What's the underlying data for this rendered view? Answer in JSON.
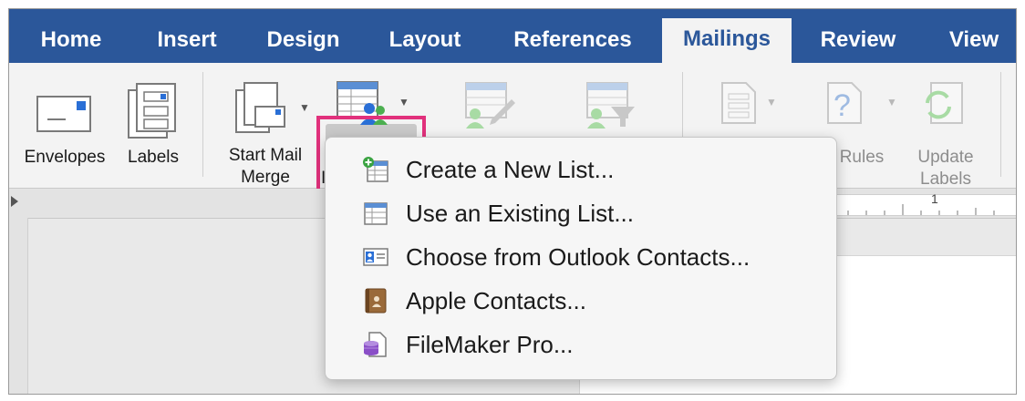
{
  "tabs": [
    {
      "label": "Home"
    },
    {
      "label": "Insert"
    },
    {
      "label": "Design"
    },
    {
      "label": "Layout"
    },
    {
      "label": "References"
    },
    {
      "label": "Mailings"
    },
    {
      "label": "Review"
    },
    {
      "label": "View"
    }
  ],
  "active_tab": "Mailings",
  "ribbon": {
    "envelopes": "Envelopes",
    "labels": "Labels",
    "start_mail_merge_line1": "Start Mail",
    "start_mail_merge_line2": "Merge",
    "select_recipients_partial": "I",
    "rules": "Rules",
    "update_labels_line1": "Update",
    "update_labels_line2": "Labels"
  },
  "ruler": {
    "mark": "1"
  },
  "menu": {
    "items": [
      {
        "label": "Create a New List...",
        "icon": "new-list-icon"
      },
      {
        "label": "Use an Existing List...",
        "icon": "existing-list-icon"
      },
      {
        "label": "Choose from Outlook Contacts...",
        "icon": "outlook-contacts-icon"
      },
      {
        "label": "Apple Contacts...",
        "icon": "apple-contacts-icon"
      },
      {
        "label": "FileMaker Pro...",
        "icon": "filemaker-icon"
      }
    ]
  },
  "colors": {
    "tabbar": "#2b579a",
    "highlight": "#e1317c"
  }
}
